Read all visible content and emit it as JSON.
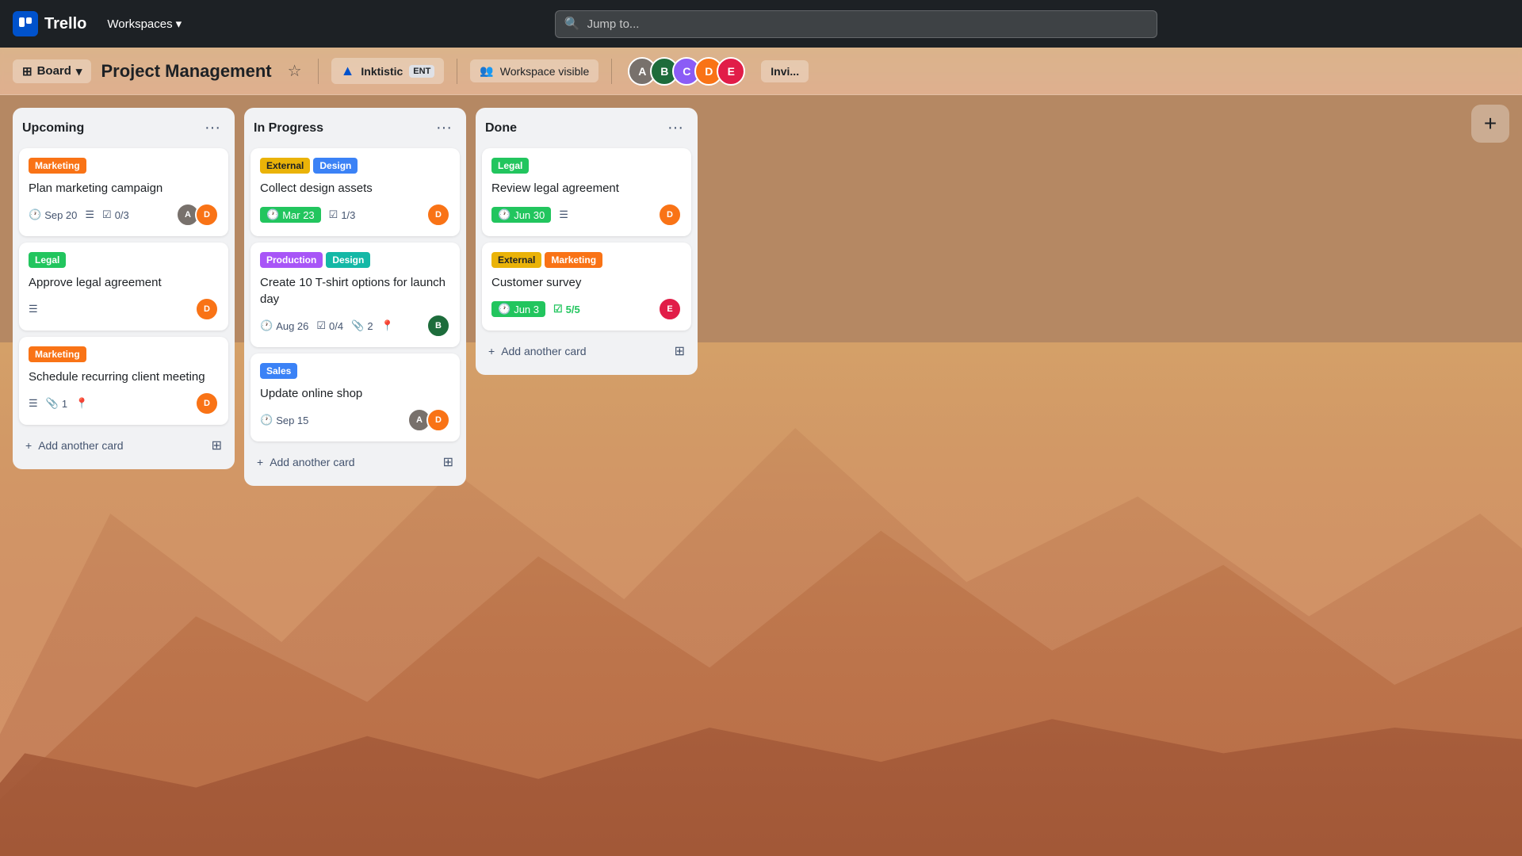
{
  "app": {
    "name": "Trello",
    "logo_text": "Trello"
  },
  "topnav": {
    "workspaces_label": "Workspaces",
    "search_placeholder": "Jump to..."
  },
  "boardheader": {
    "board_btn": "Board",
    "title": "Project Management",
    "workspace_name": "Inktistic",
    "workspace_tier": "ENT",
    "visible_label": "Workspace visible",
    "invite_label": "Invi..."
  },
  "columns": [
    {
      "id": "upcoming",
      "title": "Upcoming",
      "cards": [
        {
          "id": "c1",
          "labels": [
            {
              "text": "Marketing",
              "color": "orange"
            }
          ],
          "title": "Plan marketing campaign",
          "date": "Sep 20",
          "has_desc": true,
          "checklist": "0/3",
          "avatars": [
            "av6",
            "av2"
          ]
        },
        {
          "id": "c2",
          "labels": [
            {
              "text": "Legal",
              "color": "green"
            }
          ],
          "title": "Approve legal agreement",
          "has_desc": true,
          "avatars": [
            "av2"
          ]
        },
        {
          "id": "c3",
          "labels": [
            {
              "text": "Marketing",
              "color": "orange"
            }
          ],
          "title": "Schedule recurring client meeting",
          "has_desc": true,
          "attachments": "1",
          "has_location": true,
          "avatars": [
            "av2"
          ]
        }
      ],
      "add_card_label": "Add another card"
    },
    {
      "id": "in-progress",
      "title": "In Progress",
      "cards": [
        {
          "id": "c4",
          "labels": [
            {
              "text": "External",
              "color": "yellow"
            },
            {
              "text": "Design",
              "color": "blue"
            }
          ],
          "title": "Collect design assets",
          "date": "Mar 23",
          "date_style": "green",
          "checklist": "1/3",
          "avatars": [
            "av2"
          ]
        },
        {
          "id": "c5",
          "labels": [
            {
              "text": "Production",
              "color": "purple"
            },
            {
              "text": "Design",
              "color": "teal"
            }
          ],
          "title": "Create 10 T-shirt options for launch day",
          "date": "Aug 26",
          "attachments": "2",
          "checklist": "0/4",
          "has_location": true,
          "avatars": [
            "av3"
          ]
        },
        {
          "id": "c6",
          "labels": [
            {
              "text": "Sales",
              "color": "blue"
            }
          ],
          "title": "Update online shop",
          "date": "Sep 15",
          "avatars": [
            "av6",
            "av2"
          ]
        }
      ],
      "add_card_label": "Add another card"
    },
    {
      "id": "done",
      "title": "Done",
      "cards": [
        {
          "id": "c7",
          "labels": [
            {
              "text": "Legal",
              "color": "green"
            }
          ],
          "title": "Review legal agreement",
          "date": "Jun 30",
          "date_style": "green",
          "has_desc": true,
          "avatars": [
            "av2"
          ]
        },
        {
          "id": "c8",
          "labels": [
            {
              "text": "External",
              "color": "yellow"
            },
            {
              "text": "Marketing",
              "color": "orange"
            }
          ],
          "title": "Customer survey",
          "date": "Jun 3",
          "date_style": "green",
          "checklist": "5/5",
          "checklist_style": "green",
          "avatars": [
            "av4"
          ]
        }
      ],
      "add_card_label": "Add another card"
    }
  ]
}
